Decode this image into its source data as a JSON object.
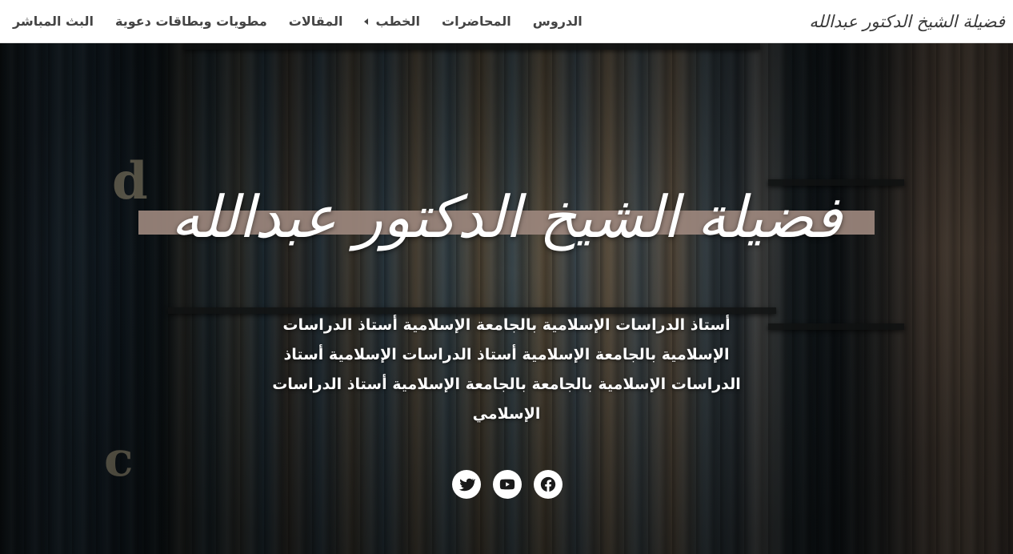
{
  "header": {
    "logo_text": "فضيلة الشيخ الدكتور عبدالله",
    "nav": [
      {
        "label": "الدروس"
      },
      {
        "label": "المحاضرات"
      },
      {
        "label": "الخطب",
        "has_submenu": true
      },
      {
        "label": "المقالات"
      },
      {
        "label": "مطويات وبطاقات دعوية"
      },
      {
        "label": "البث المباشر"
      }
    ]
  },
  "hero": {
    "title": "فضيلة الشيخ الدكتور عبدالله",
    "description": "أستاذ الدراسات الإسلامية بالجامعة الإسلامية أستاذ الدراسات الإسلامية بالجامعة الإسلامية أستاذ الدراسات الإسلامية أستاذ الدراسات الإسلامية بالجامعة بالجامعة الإسلامية أستاذ الدراسات الإسلامي",
    "title_band_color": "#9c877d"
  },
  "social": [
    {
      "name": "twitter-icon"
    },
    {
      "name": "youtube-icon"
    },
    {
      "name": "facebook-icon"
    }
  ],
  "colors": {
    "header_bg": "#ffffff",
    "nav_text": "#444444",
    "hero_text": "#ffffff"
  }
}
